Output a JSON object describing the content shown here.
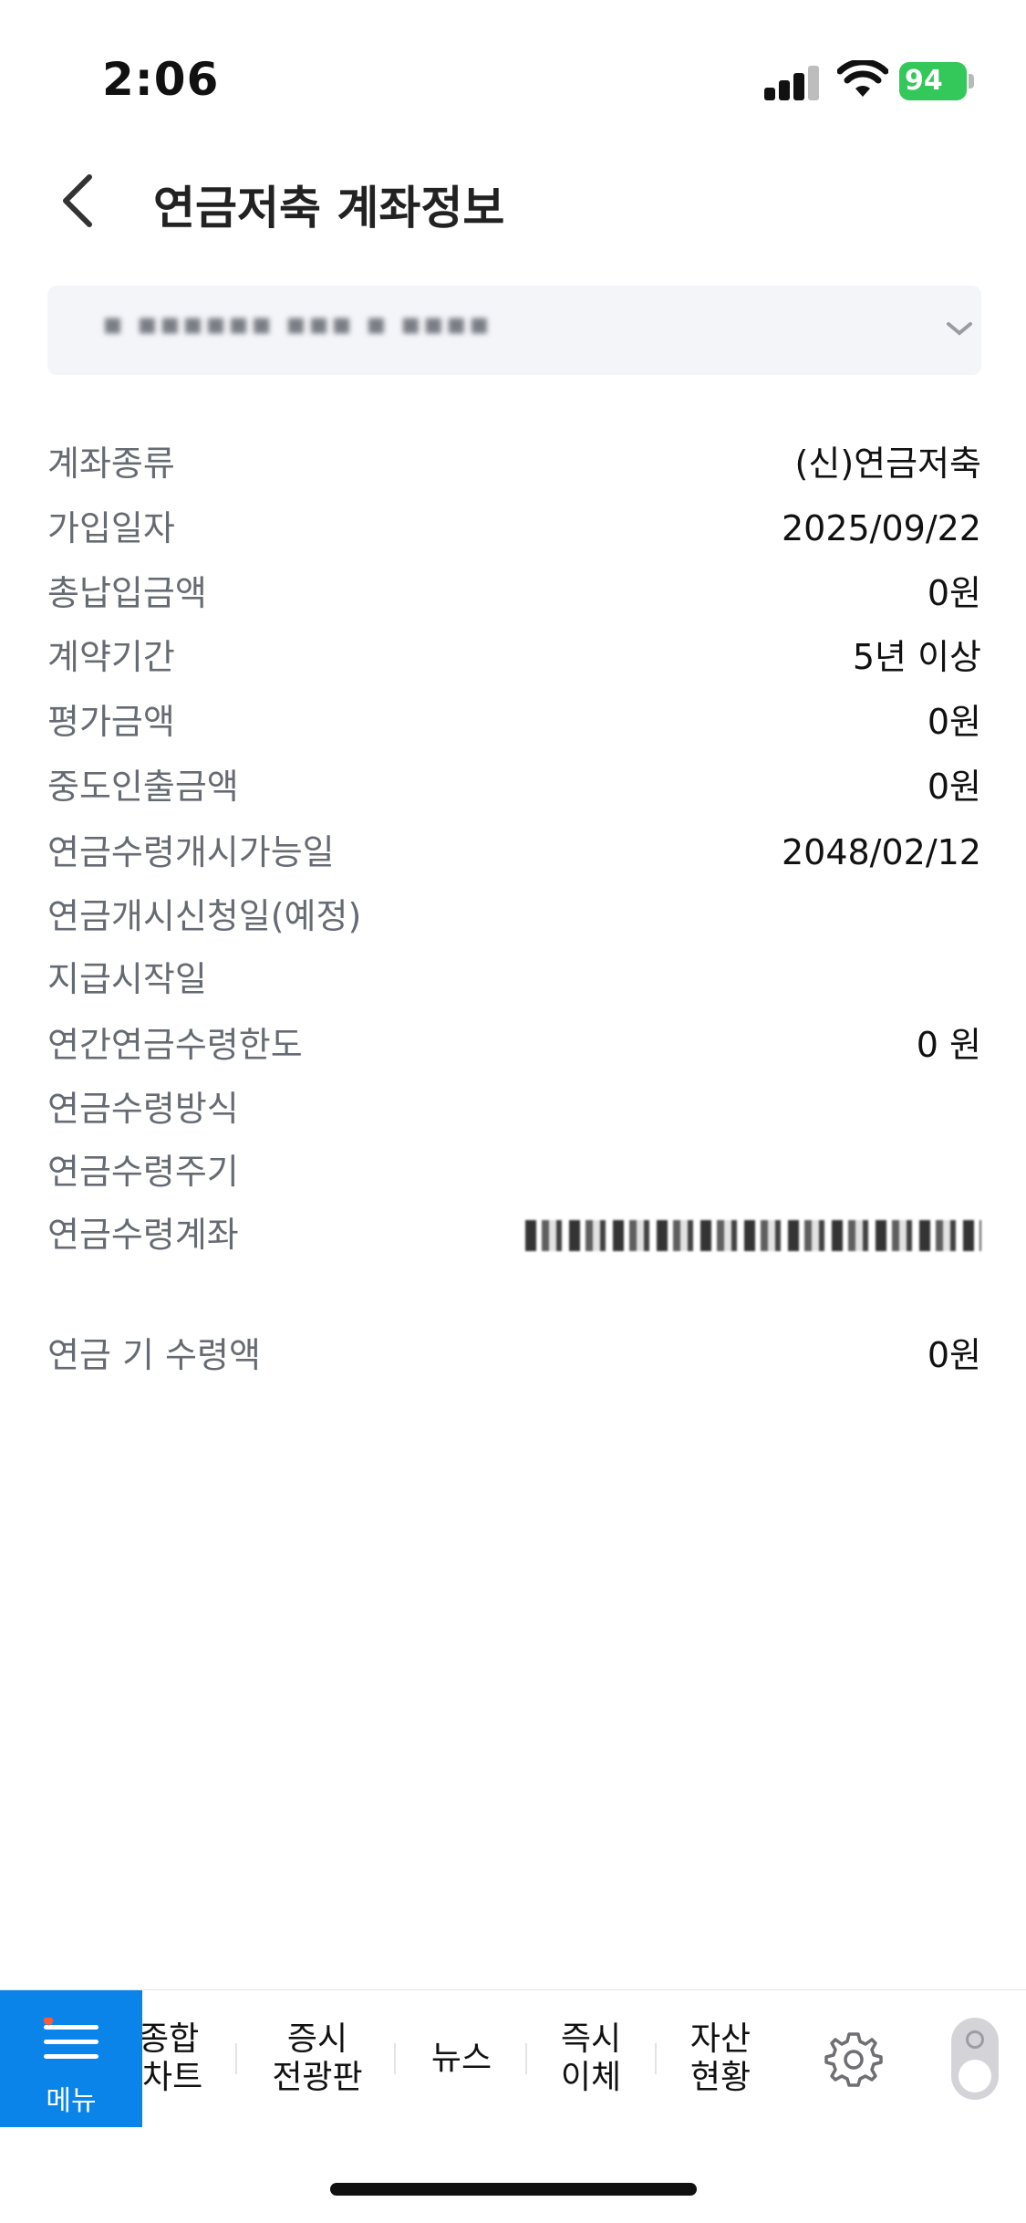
{
  "status_bar": {
    "time": "2:06",
    "battery": "94"
  },
  "header": {
    "title": "연금저축 계좌정보"
  },
  "account_selector": {
    "value": "▪ ▪▪▪▪▪▪ ▪▪▪ ▪ ▪▪▪▪"
  },
  "info": [
    {
      "label": "계좌종류",
      "value": "(신)연금저축"
    },
    {
      "label": "가입일자",
      "value": "2025/09/22"
    },
    {
      "label": "총납입금액",
      "value": "0원"
    },
    {
      "label": "계약기간",
      "value": "5년 이상"
    },
    {
      "label": "평가금액",
      "value": "0원"
    },
    {
      "label": "중도인출금액",
      "value": "0원"
    },
    {
      "label": "연금수령개시가능일",
      "value": "2048/02/12"
    },
    {
      "label": "연금개시신청일(예정)",
      "value": ""
    },
    {
      "label": "지급시작일",
      "value": ""
    },
    {
      "label": "연간연금수령한도",
      "value": "0 원"
    },
    {
      "label": "연금수령방식",
      "value": ""
    },
    {
      "label": "연금수령주기",
      "value": ""
    },
    {
      "label": "연금수령계좌",
      "value": ""
    },
    {
      "label": "연금 기 수령액",
      "value": "0원"
    }
  ],
  "bottom_nav": {
    "menu_label": "메뉴",
    "items": [
      {
        "label": "종합\n차트"
      },
      {
        "label": "증시\n전광판"
      },
      {
        "label": "뉴스"
      },
      {
        "label": "즉시\n이체"
      },
      {
        "label": "자산\n현황"
      }
    ]
  },
  "colors": {
    "accent": "#0a84e8",
    "battery": "#34c759",
    "label": "#666b73"
  }
}
